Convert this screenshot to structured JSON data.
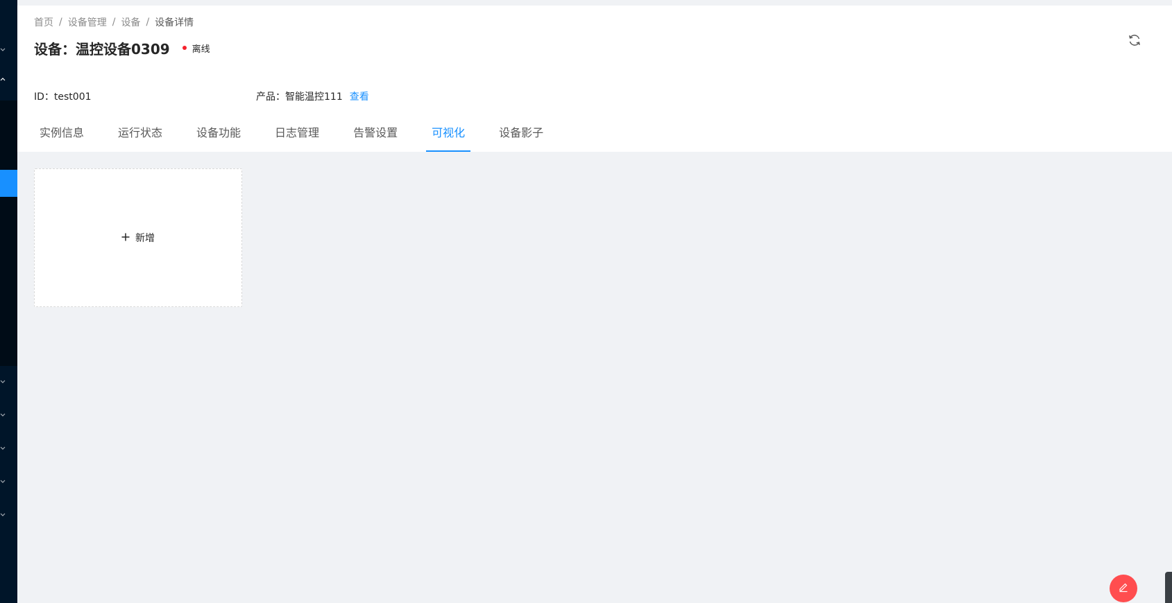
{
  "breadcrumb": {
    "items": [
      "首页",
      "设备管理",
      "设备"
    ],
    "current": "设备详情",
    "separator": "/"
  },
  "device": {
    "title": "设备：温控设备0309",
    "status": "离线",
    "status_color": "#f5222d"
  },
  "info": {
    "id_text": "ID：test001",
    "product_text": "产品：智能温控111",
    "product_link": "查看"
  },
  "tabs": [
    {
      "label": "实例信息"
    },
    {
      "label": "运行状态"
    },
    {
      "label": "设备功能"
    },
    {
      "label": "日志管理"
    },
    {
      "label": "告警设置"
    },
    {
      "label": "可视化",
      "active": true
    },
    {
      "label": "设备影子"
    }
  ],
  "add_card": {
    "label": "新增"
  },
  "colors": {
    "primary": "#1890ff",
    "sidebar_bg": "#001529",
    "danger": "#ff4d4f"
  },
  "icons": {
    "refresh": "refresh-icon",
    "plus": "plus-icon",
    "edit": "edit-icon"
  }
}
